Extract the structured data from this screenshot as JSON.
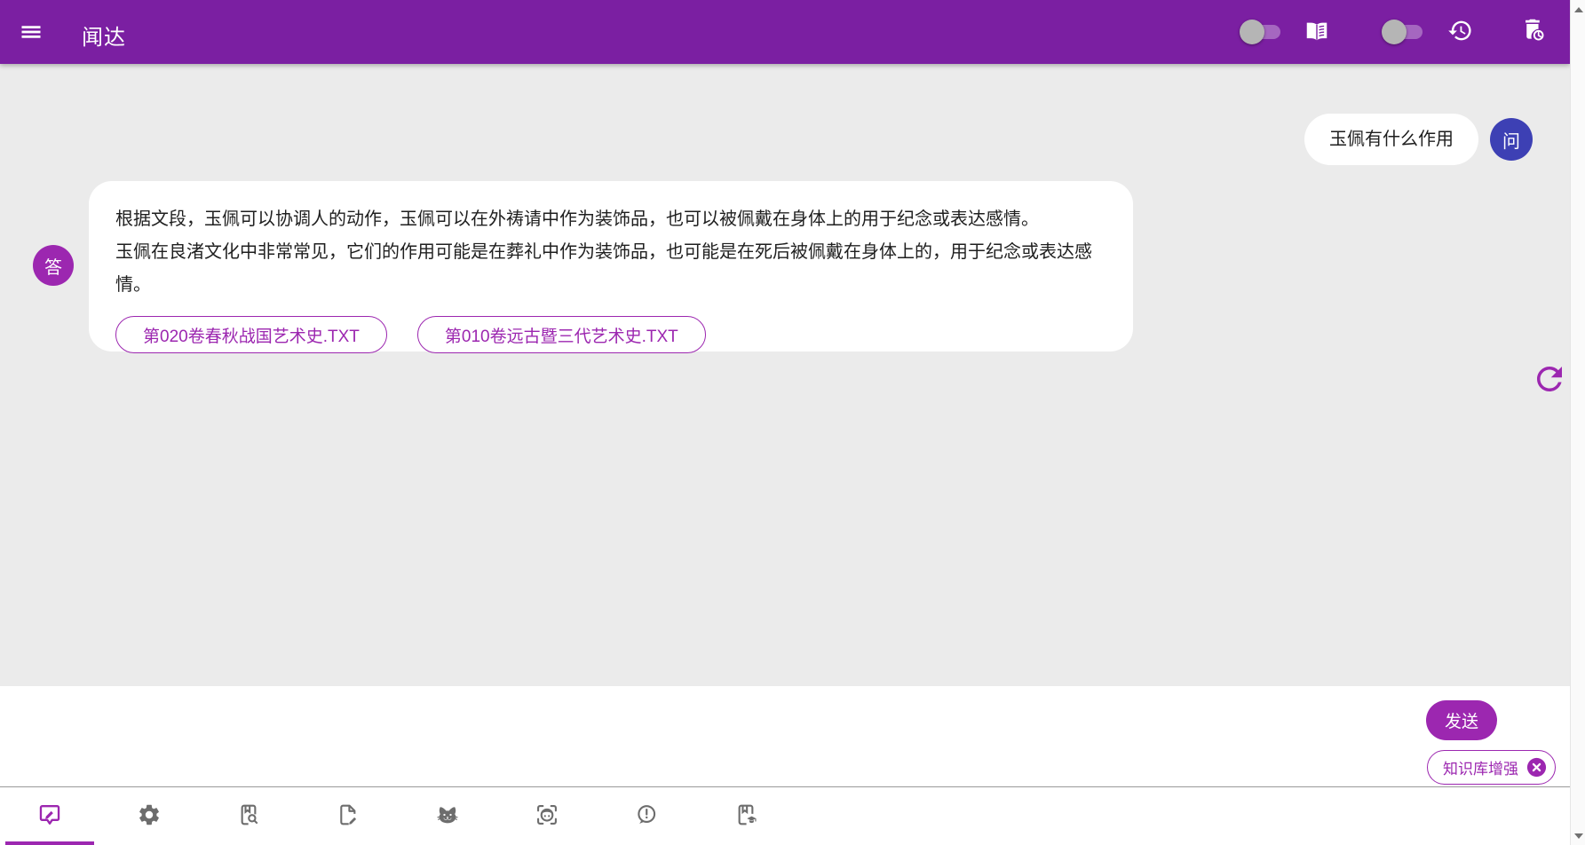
{
  "app": {
    "title": "闻达"
  },
  "header": {
    "menu_icon": "hamburger-menu",
    "controls": {
      "toggle_1_state": "off",
      "book_icon": "open-book",
      "toggle_2_state": "off",
      "history_icon": "history-clock",
      "auto_delete_icon": "trash-with-clock"
    }
  },
  "chat": {
    "question": {
      "avatar_label": "问",
      "text": "玉佩有什么作用"
    },
    "answer": {
      "avatar_label": "答",
      "lines": [
        "根据文段，玉佩可以协调人的动作，玉佩可以在外祷请中作为装饰品，也可以被佩戴在身体上的用于纪念或表达感情。",
        "玉佩在良渚文化中非常常见，它们的作用可能是在葬礼中作为装饰品，也可能是在死后被佩戴在身体上的，用于纪念或表达感情。"
      ],
      "sources": [
        "第020卷春秋战国艺术史.TXT",
        "第010卷远古暨三代艺术史.TXT"
      ]
    },
    "refresh_icon": "refresh-circular-arrow"
  },
  "composer": {
    "send_label": "发送",
    "kb_chip": {
      "label": "知识库增强",
      "close_icon": "circle-x"
    }
  },
  "toolbar": {
    "active_index": 0,
    "tabs": [
      {
        "name": "chat",
        "icon": "speech-bubble-pencil"
      },
      {
        "name": "settings",
        "icon": "gear"
      },
      {
        "name": "knowledge-search",
        "icon": "book-magnifier"
      },
      {
        "name": "document-edit",
        "icon": "file-pencil"
      },
      {
        "name": "cat",
        "icon": "cat-face"
      },
      {
        "name": "face-scan",
        "icon": "face-in-scan-frame"
      },
      {
        "name": "feedback",
        "icon": "speech-bubble-exclamation"
      },
      {
        "name": "library",
        "icon": "book-graduation"
      }
    ]
  },
  "scrollbar": {
    "up_icon": "triangle-up",
    "down_icon": "triangle-down"
  },
  "colors": {
    "header_purple": "#7b1fa2",
    "accent_purple": "#9c27b0",
    "question_avatar_indigo": "#3d40b4",
    "chat_background": "#ebebeb",
    "toolbar_icon_gray": "#6d6d6d"
  }
}
